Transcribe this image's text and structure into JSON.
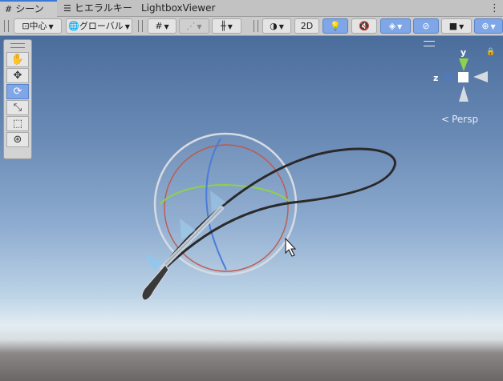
{
  "tabs": [
    {
      "label": "シーン",
      "icon": "grid-icon",
      "active": true
    },
    {
      "label": "ヒエラルキー",
      "icon": "list-icon",
      "active": false
    },
    {
      "label": "LightboxViewer",
      "icon": "",
      "active": false
    }
  ],
  "tab_menu": "⋮",
  "toolbar": {
    "pivot_label": "中心",
    "space_label": "グローバル",
    "mode_2d_label": "2D"
  },
  "tools": [
    "hand-tool",
    "move-tool",
    "rotate-tool",
    "scale-tool",
    "rect-tool",
    "transform-tool"
  ],
  "active_tool": "rotate-tool",
  "gizmo": {
    "y_label": "y",
    "z_label": "z",
    "persp_label": "Persp"
  },
  "colors": {
    "accent": "#7fa6e6",
    "x_axis": "#d6573d",
    "y_axis": "#8ed14d",
    "z_axis": "#4a7bd8"
  }
}
